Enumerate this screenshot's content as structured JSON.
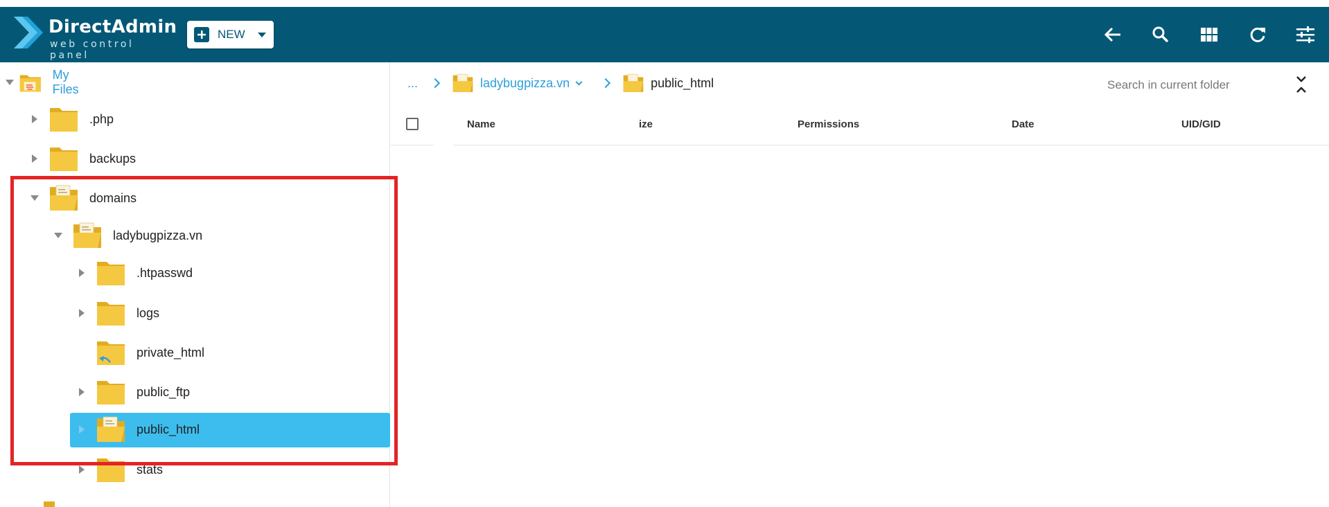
{
  "header": {
    "logo_title": "DirectAdmin",
    "logo_subtitle": "web control panel",
    "new_label": "NEW",
    "bg_color": "#045876",
    "icons": [
      "arrow-left-icon",
      "search-icon",
      "grid-view-icon",
      "refresh-icon",
      "settings-sliders-icon"
    ]
  },
  "tree": {
    "root": "My Files",
    "items": {
      "php": ".php",
      "backups": "backups",
      "domains": "domains",
      "domain": "ladybugpizza.vn",
      "htpasswd": ".htpasswd",
      "logs": "logs",
      "private_html": "private_html",
      "public_ftp": "public_ftp",
      "public_html": "public_html",
      "stats": "stats"
    },
    "selected": "public_html"
  },
  "breadcrumb": {
    "ellipsis": "...",
    "domain": "ladybugpizza.vn",
    "current": "public_html"
  },
  "search": {
    "placeholder": "Search in current folder"
  },
  "table": {
    "columns": {
      "name": "Name",
      "size": "ize",
      "permissions": "Permissions",
      "date": "Date",
      "uid": "UID/GID"
    }
  }
}
